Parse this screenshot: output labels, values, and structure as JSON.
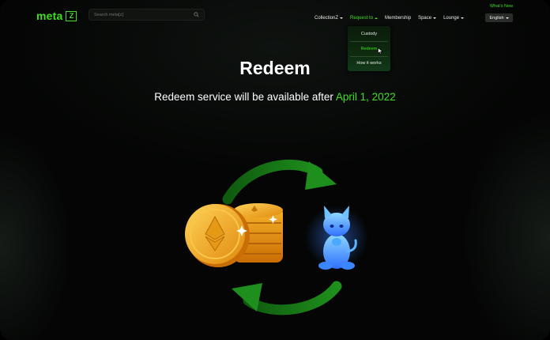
{
  "header": {
    "logo_text": "meta",
    "logo_mark": "Z",
    "search_placeholder": "Search meta[z]",
    "whats_new": "What's New",
    "nav": [
      {
        "label": "CollectionZ"
      },
      {
        "label": "Request to"
      },
      {
        "label": "Membership"
      },
      {
        "label": "Space"
      },
      {
        "label": "Lounge"
      }
    ],
    "language": "English"
  },
  "dropdown": {
    "items": [
      {
        "label": "Custody"
      },
      {
        "label": "Redeem"
      },
      {
        "label": "How it works"
      }
    ]
  },
  "hero": {
    "title": "Redeem",
    "subtitle_prefix": "Redeem service will be available after ",
    "subtitle_date": "April 1, 2022"
  },
  "colors": {
    "accent": "#3ee01e",
    "background": "#040504",
    "coin": "#f5a623",
    "figure": "#2f6fff"
  },
  "icons": [
    "search-icon",
    "ethereum-coin-icon",
    "exchange-arrow-icon",
    "nft-figure-icon"
  ]
}
